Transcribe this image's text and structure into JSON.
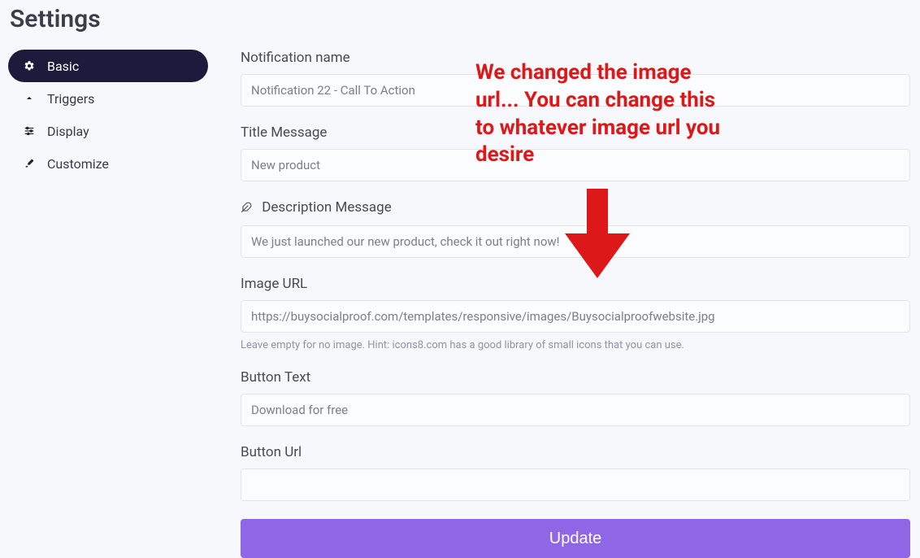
{
  "pageTitle": "Settings",
  "sidebar": {
    "items": [
      {
        "label": "Basic"
      },
      {
        "label": "Triggers"
      },
      {
        "label": "Display"
      },
      {
        "label": "Customize"
      }
    ]
  },
  "form": {
    "notificationName": {
      "label": "Notification name",
      "value": "Notification 22 - Call To Action"
    },
    "titleMessage": {
      "label": "Title Message",
      "value": "New product"
    },
    "descriptionMessage": {
      "label": "Description Message",
      "value": "We just launched our new product, check it out right now!"
    },
    "imageUrl": {
      "label": "Image URL",
      "value": "https://buysocialproof.com/templates/responsive/images/Buysocialproofwebsite.jpg",
      "hint": "Leave empty for no image. Hint: icons8.com has a good library of small icons that you can use."
    },
    "buttonText": {
      "label": "Button Text",
      "value": "Download for free"
    },
    "buttonUrl": {
      "label": "Button Url",
      "value": ""
    },
    "submitLabel": "Update"
  },
  "annotation": "We changed the image url... You can change this to whatever image url you desire"
}
